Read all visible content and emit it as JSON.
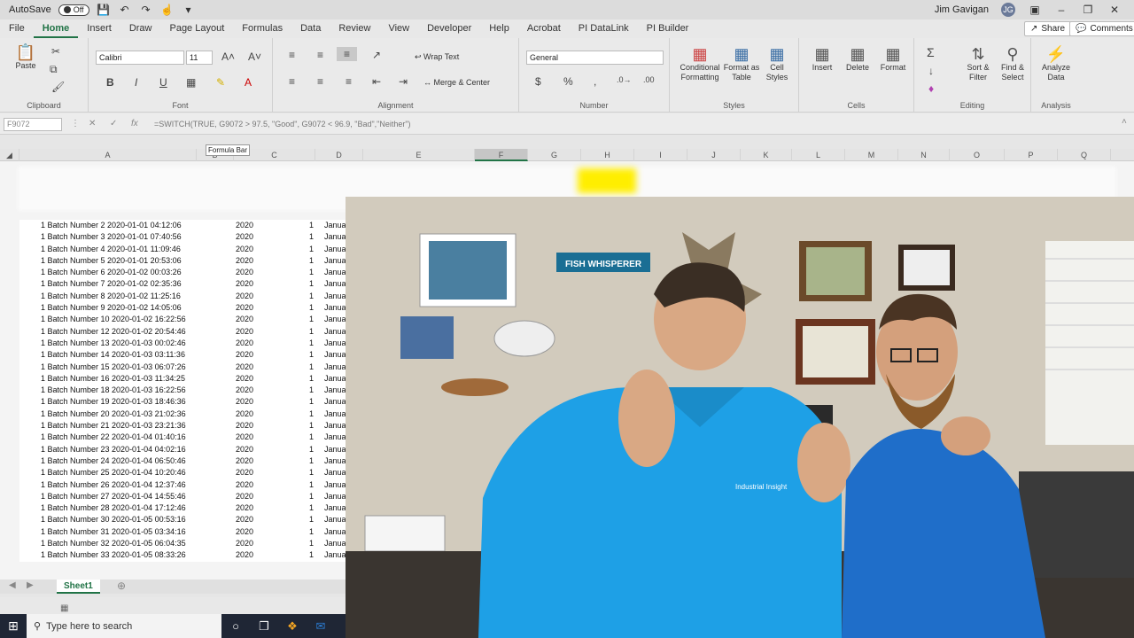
{
  "titlebar": {
    "autosave": "AutoSave",
    "toggle": "Off",
    "user": "Jim Gavigan"
  },
  "menu": {
    "tabs": [
      "File",
      "Home",
      "Insert",
      "Draw",
      "Page Layout",
      "Formulas",
      "Data",
      "Review",
      "View",
      "Developer",
      "Help",
      "Acrobat",
      "PI DataLink",
      "PI Builder"
    ],
    "share": "Share",
    "comments": "Comments"
  },
  "ribbon": {
    "clipboard": {
      "paste": "Paste",
      "label": "Clipboard"
    },
    "font": {
      "name": "Calibri",
      "size": "11",
      "label": "Font"
    },
    "alignment": {
      "wrap": "Wrap Text",
      "merge": "Merge & Center",
      "label": "Alignment"
    },
    "number": {
      "format": "General",
      "label": "Number"
    },
    "styles": {
      "conditional": "Conditional Formatting",
      "format_table": "Format as Table",
      "cell_styles": "Cell Styles",
      "label": "Styles"
    },
    "cells": {
      "insert": "Insert",
      "delete": "Delete",
      "format": "Format",
      "label": "Cells"
    },
    "editing": {
      "sort": "Sort & Filter",
      "find": "Find & Select",
      "label": "Editing"
    },
    "analysis": {
      "analyze": "Analyze Data",
      "label": "Analysis"
    }
  },
  "formula_bar": {
    "namebox": "F9072",
    "formula": "=SWITCH(TRUE, G9072 > 97.5, \"Good\", G9072 < 96.9, \"Bad\",\"Neither\")",
    "tooltip": "Formula Bar"
  },
  "columns": [
    "A",
    "B",
    "C",
    "D",
    "E",
    "F",
    "G",
    "H",
    "I",
    "J",
    "K",
    "L",
    "M",
    "N",
    "O",
    "P",
    "Q"
  ],
  "rows": [
    {
      "a": "1 Batch Number 2 2020-01-01 04:12:06",
      "b": "2020",
      "c": "1",
      "d": "Janua"
    },
    {
      "a": "1 Batch Number 3 2020-01-01 07:40:56",
      "b": "2020",
      "c": "1",
      "d": "Janua"
    },
    {
      "a": "1 Batch Number 4 2020-01-01 11:09:46",
      "b": "2020",
      "c": "1",
      "d": "Janua"
    },
    {
      "a": "1 Batch Number 5 2020-01-01 20:53:06",
      "b": "2020",
      "c": "1",
      "d": "Janua"
    },
    {
      "a": "1 Batch Number 6 2020-01-02 00:03:26",
      "b": "2020",
      "c": "1",
      "d": "Janua"
    },
    {
      "a": "1 Batch Number 7 2020-01-02 02:35:36",
      "b": "2020",
      "c": "1",
      "d": "Janua"
    },
    {
      "a": "1 Batch Number 8 2020-01-02 11:25:16",
      "b": "2020",
      "c": "1",
      "d": "Janua"
    },
    {
      "a": "1 Batch Number 9 2020-01-02 14:05:06",
      "b": "2020",
      "c": "1",
      "d": "Janua"
    },
    {
      "a": "1 Batch Number 10 2020-01-02 16:22:56",
      "b": "2020",
      "c": "1",
      "d": "Janua"
    },
    {
      "a": "1 Batch Number 12 2020-01-02 20:54:46",
      "b": "2020",
      "c": "1",
      "d": "Janua"
    },
    {
      "a": "1 Batch Number 13 2020-01-03 00:02:46",
      "b": "2020",
      "c": "1",
      "d": "Janua"
    },
    {
      "a": "1 Batch Number 14 2020-01-03 03:11:36",
      "b": "2020",
      "c": "1",
      "d": "Janua"
    },
    {
      "a": "1 Batch Number 15 2020-01-03 06:07:26",
      "b": "2020",
      "c": "1",
      "d": "Janua"
    },
    {
      "a": "1 Batch Number 16 2020-01-03 11:34:25",
      "b": "2020",
      "c": "1",
      "d": "Janua"
    },
    {
      "a": "1 Batch Number 18 2020-01-03 16:22:56",
      "b": "2020",
      "c": "1",
      "d": "Janua"
    },
    {
      "a": "1 Batch Number 19 2020-01-03 18:46:36",
      "b": "2020",
      "c": "1",
      "d": "Janua"
    },
    {
      "a": "1 Batch Number 20 2020-01-03 21:02:36",
      "b": "2020",
      "c": "1",
      "d": "Janua"
    },
    {
      "a": "1 Batch Number 21 2020-01-03 23:21:36",
      "b": "2020",
      "c": "1",
      "d": "Janua"
    },
    {
      "a": "1 Batch Number 22 2020-01-04 01:40:16",
      "b": "2020",
      "c": "1",
      "d": "Janua"
    },
    {
      "a": "1 Batch Number 23 2020-01-04 04:02:16",
      "b": "2020",
      "c": "1",
      "d": "Janua"
    },
    {
      "a": "1 Batch Number 24 2020-01-04 06:50:46",
      "b": "2020",
      "c": "1",
      "d": "Janua"
    },
    {
      "a": "1 Batch Number 25 2020-01-04 10:20:46",
      "b": "2020",
      "c": "1",
      "d": "Janua"
    },
    {
      "a": "1 Batch Number 26 2020-01-04 12:37:46",
      "b": "2020",
      "c": "1",
      "d": "Janua"
    },
    {
      "a": "1 Batch Number 27 2020-01-04 14:55:46",
      "b": "2020",
      "c": "1",
      "d": "Janua"
    },
    {
      "a": "1 Batch Number 28 2020-01-04 17:12:46",
      "b": "2020",
      "c": "1",
      "d": "Janua"
    },
    {
      "a": "1 Batch Number 30 2020-01-05 00:53:16",
      "b": "2020",
      "c": "1",
      "d": "Janua"
    },
    {
      "a": "1 Batch Number 31 2020-01-05 03:34:16",
      "b": "2020",
      "c": "1",
      "d": "Janua"
    },
    {
      "a": "1 Batch Number 32 2020-01-05 06:04:35",
      "b": "2020",
      "c": "1",
      "d": "Janua"
    },
    {
      "a": "1 Batch Number 33 2020-01-05 08:33:26",
      "b": "2020",
      "c": "1",
      "d": "Janua"
    }
  ],
  "sheet_tab": "Sheet1",
  "taskbar": {
    "search": "Type here to search"
  },
  "webcam": {
    "sign": "FISH WHISPERER",
    "shirt_logo": "Industrial Insight"
  },
  "colors": {
    "excel_green": "#217346",
    "shirt_blue": "#1ea0e6"
  }
}
